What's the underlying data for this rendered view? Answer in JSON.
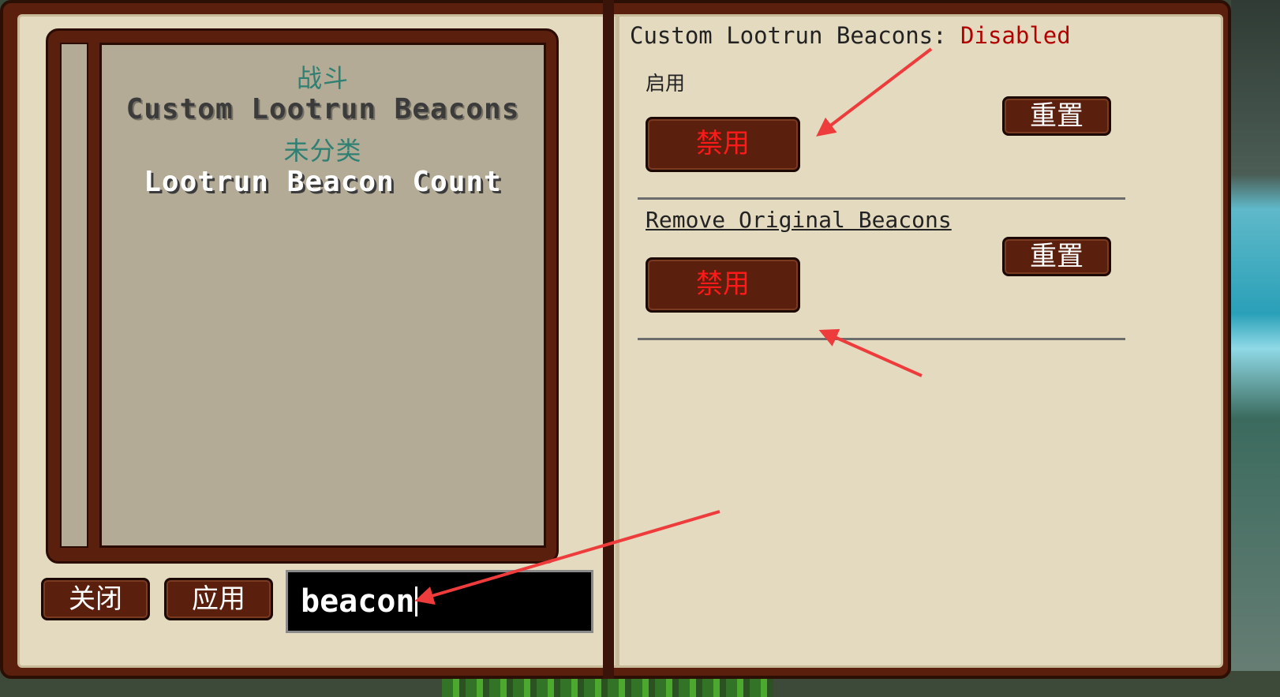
{
  "left": {
    "categories": [
      {
        "label": "战斗",
        "items": [
          "Custom Lootrun Beacons"
        ]
      },
      {
        "label": "未分类",
        "items": [
          "Lootrun Beacon Count"
        ]
      }
    ],
    "close_label": "关闭",
    "apply_label": "应用",
    "search_value": "beacon"
  },
  "right": {
    "config1": {
      "title": "Custom Lootrun Beacons: ",
      "status": "Disabled",
      "description": "启用",
      "toggle_label": "禁用",
      "reset_label": "重置"
    },
    "config2": {
      "title": "Remove Original Beacons",
      "toggle_label": "禁用",
      "reset_label": "重置"
    }
  },
  "colors": {
    "book_frame": "#5a1f0d",
    "page": "#e4dac0",
    "category_text": "#2f7f73",
    "disabled_text": "#b30000",
    "toggle_text": "#ff1a1a",
    "annotation_arrow": "#ee3b3b"
  },
  "icons": [
    "annotation-arrow"
  ]
}
